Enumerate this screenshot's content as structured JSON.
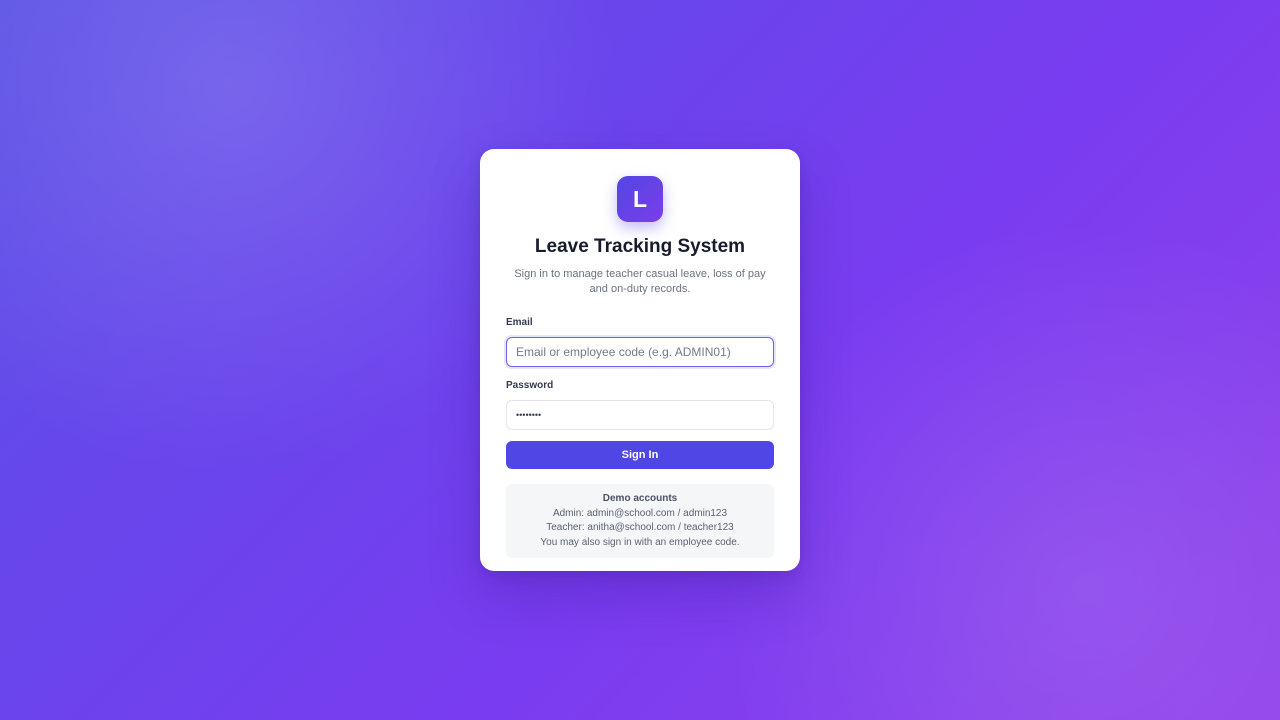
{
  "app": {
    "logo_letter": "L",
    "title": "Leave Tracking System",
    "subtitle": "Sign in to manage teacher casual leave, loss of pay and on-duty records."
  },
  "form": {
    "email_label": "Email",
    "email_placeholder": "Email or employee code (e.g. ADMIN01)",
    "email_value": "",
    "password_label": "Password",
    "password_value": "••••••••",
    "signin_label": "Sign In"
  },
  "demo": {
    "title": "Demo accounts",
    "admin_line": "Admin: admin@school.com / admin123",
    "teacher_line": "Teacher: anitha@school.com / teacher123",
    "note": "You may also sign in with an employee code."
  },
  "colors": {
    "accent": "#5046e5",
    "background_start": "#5b52e6",
    "background_end": "#9244ea"
  }
}
